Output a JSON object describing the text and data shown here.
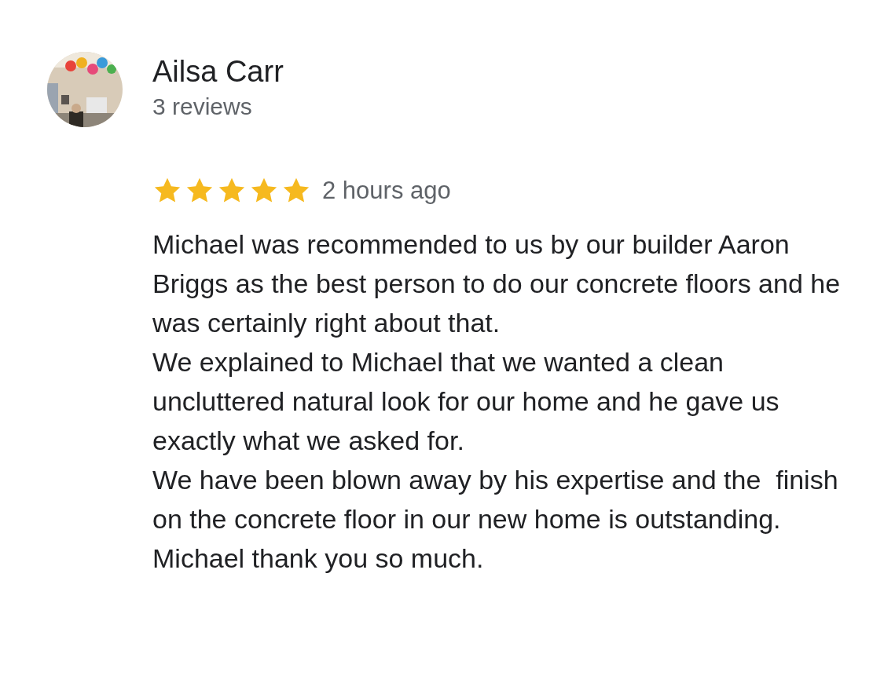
{
  "reviewer": {
    "name": "Ailsa Carr",
    "review_count": "3 reviews"
  },
  "review": {
    "stars": 5,
    "time": "2 hours ago",
    "paragraphs": [
      "Michael was recommended to us by our builder Aaron Briggs as the best person to do our concrete floors and he was certainly right about that.",
      "We explained to Michael that we wanted a clean uncluttered natural look for our home and he gave us exactly what we asked for.",
      "We have been blown away by his expertise and the  finish on the concrete floor in our new home is outstanding.  Michael thank you so much."
    ]
  }
}
